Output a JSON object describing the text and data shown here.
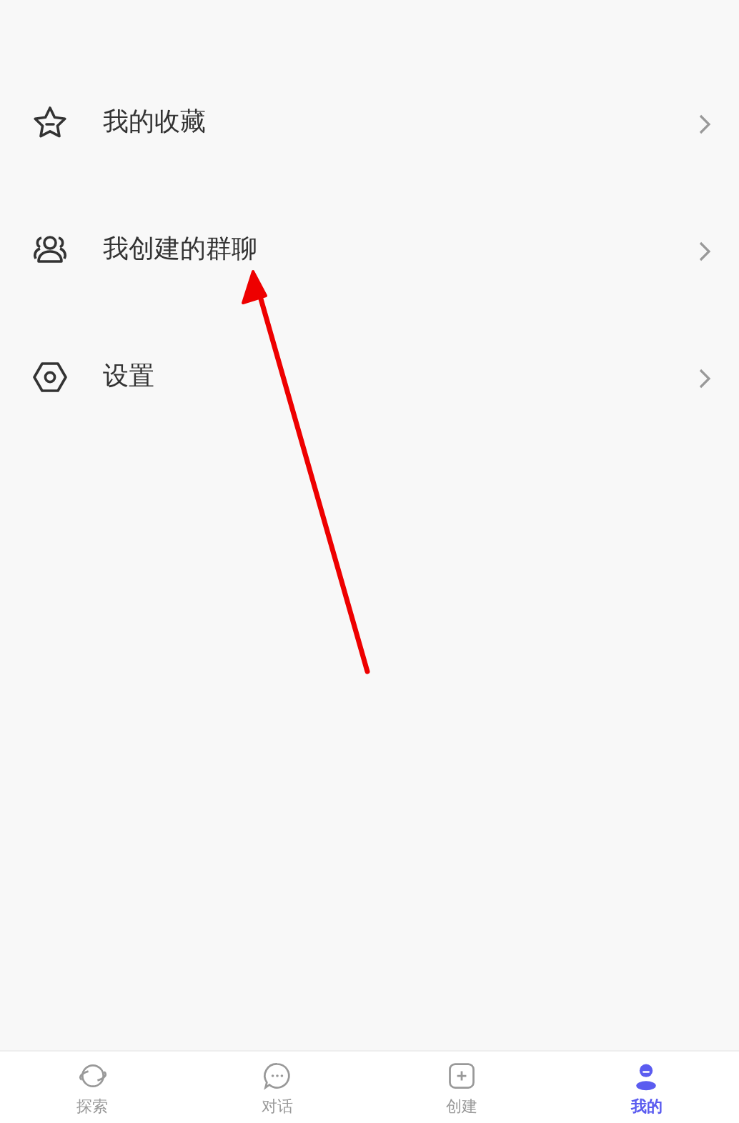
{
  "menu": [
    {
      "label": "我的收藏"
    },
    {
      "label": "我创建的群聊"
    },
    {
      "label": "设置"
    }
  ],
  "tab_bar": [
    {
      "label": "探索",
      "selected": false
    },
    {
      "label": "对话",
      "selected": false
    },
    {
      "label": "创建",
      "selected": false
    },
    {
      "label": "我的",
      "selected": true
    }
  ]
}
